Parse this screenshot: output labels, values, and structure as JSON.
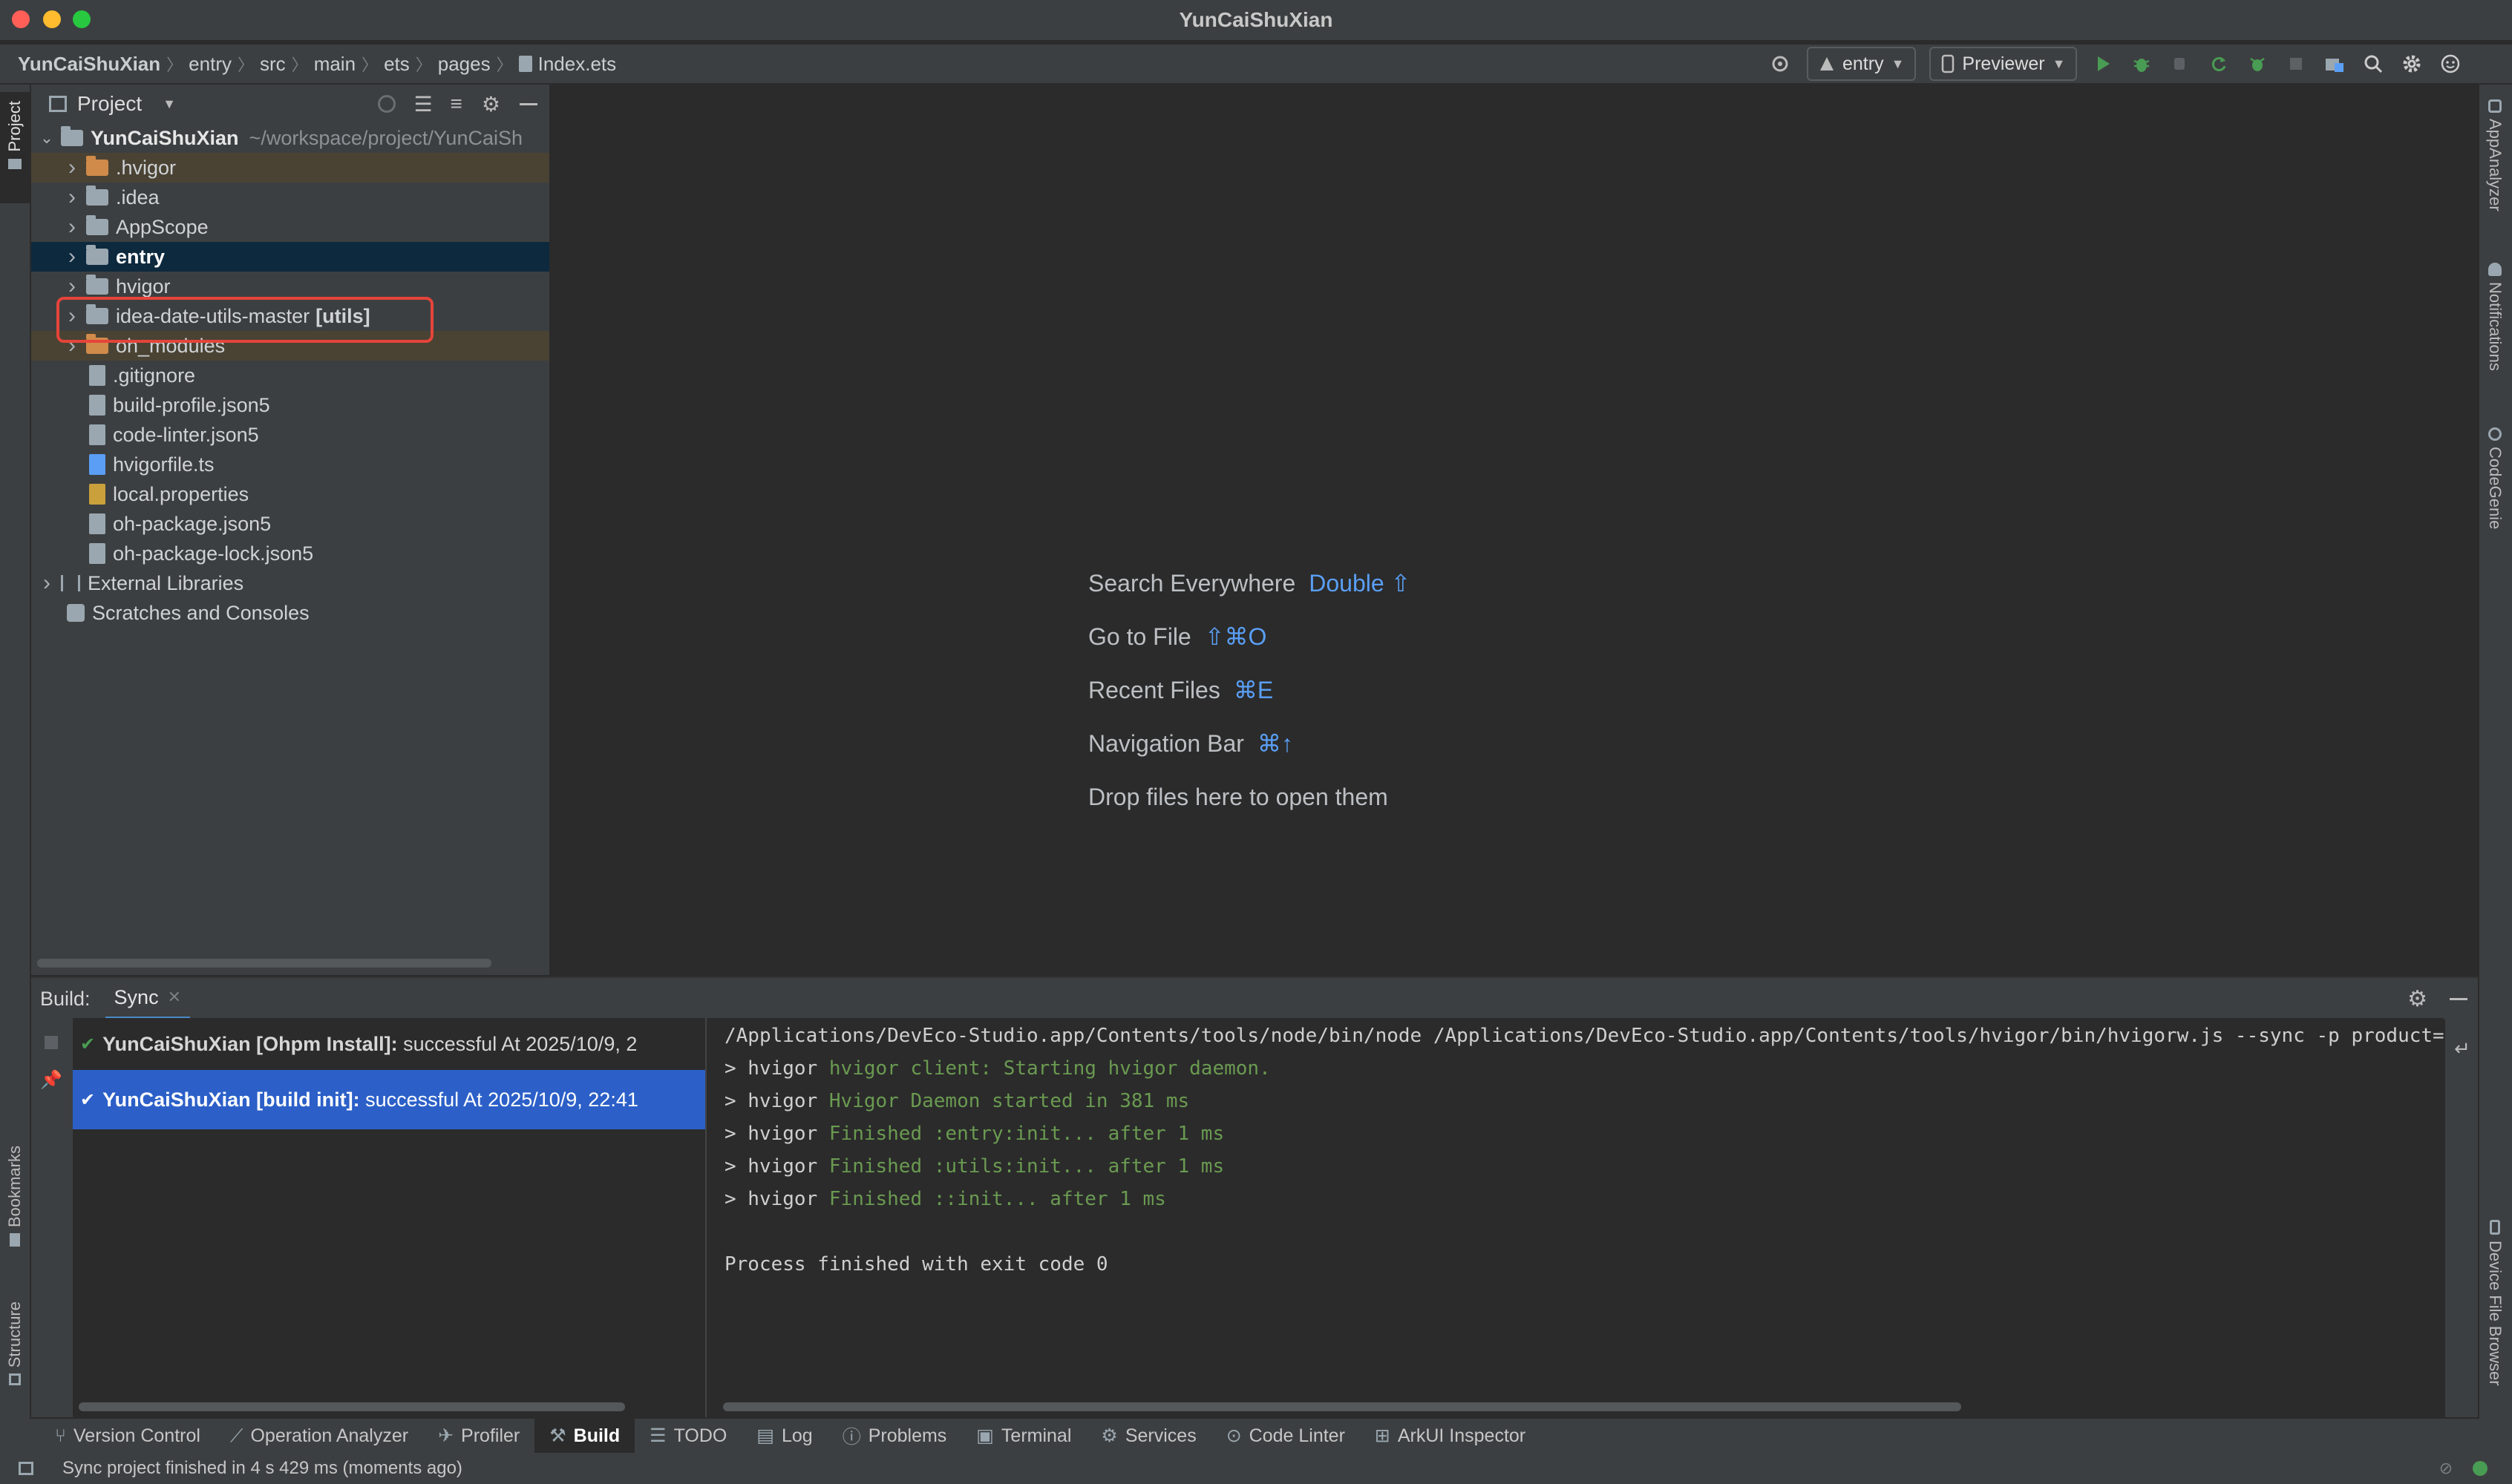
{
  "window": {
    "title": "YunCaiShuXian"
  },
  "breadcrumb": [
    "YunCaiShuXian",
    "entry",
    "src",
    "main",
    "ets",
    "pages",
    "Index.ets"
  ],
  "toolbar": {
    "module_selector": "entry",
    "device_selector": "Previewer"
  },
  "left_strip": {
    "project_label": "Project",
    "bookmarks_label": "Bookmarks",
    "structure_label": "Structure"
  },
  "right_strip": {
    "app_analyzer": "AppAnalyzer",
    "notifications": "Notifications",
    "code_genie": "CodeGenie",
    "device_file_browser": "Device File Browser"
  },
  "project_panel": {
    "title": "Project",
    "root": {
      "name": "YunCaiShuXian",
      "path": "~/workspace/project/YunCaiSh"
    },
    "items": [
      {
        "name": ".hvigor",
        "kind": "folder-excluded"
      },
      {
        "name": ".idea",
        "kind": "folder"
      },
      {
        "name": "AppScope",
        "kind": "folder"
      },
      {
        "name": "entry",
        "kind": "module"
      },
      {
        "name": "hvigor",
        "kind": "folder"
      },
      {
        "name": "idea-date-utils-master",
        "suffix": "[utils]",
        "kind": "module"
      },
      {
        "name": "oh_modules",
        "kind": "folder-excluded"
      },
      {
        "name": ".gitignore",
        "kind": "file"
      },
      {
        "name": "build-profile.json5",
        "kind": "file"
      },
      {
        "name": "code-linter.json5",
        "kind": "file"
      },
      {
        "name": "hvigorfile.ts",
        "kind": "ts-file"
      },
      {
        "name": "local.properties",
        "kind": "properties-file"
      },
      {
        "name": "oh-package.json5",
        "kind": "file"
      },
      {
        "name": "oh-package-lock.json5",
        "kind": "file"
      }
    ],
    "external_libraries": "External Libraries",
    "scratches": "Scratches and Consoles",
    "highlight_color": "#e5443a"
  },
  "editor_tips": [
    {
      "label": "Search Everywhere",
      "shortcut": "Double ⇧"
    },
    {
      "label": "Go to File",
      "shortcut": "⇧⌘O"
    },
    {
      "label": "Recent Files",
      "shortcut": "⌘E"
    },
    {
      "label": "Navigation Bar",
      "shortcut": "⌘↑"
    },
    {
      "label": "Drop files here to open them",
      "shortcut": ""
    }
  ],
  "build_panel": {
    "label": "Build:",
    "tab": "Sync",
    "items": [
      {
        "bold": "YunCaiShuXian [Ohpm Install]:",
        "text": " successful At 2025/10/9, 2"
      },
      {
        "bold": "YunCaiShuXian [build init]:",
        "text": " successful At 2025/10/9, 22:41"
      }
    ],
    "console": [
      {
        "prefix": "/Applications/DevEco-Studio.app/Contents/tools/node/bin/node /Applications/DevEco-Studio.app/Contents/tools/hvigor/bin/hvigorw.js --sync -p product=d",
        "msg": ""
      },
      {
        "prefix": "> hvigor ",
        "msg": "hvigor client: Starting hvigor daemon."
      },
      {
        "prefix": "> hvigor ",
        "msg": "Hvigor Daemon started in 381 ms"
      },
      {
        "prefix": "> hvigor ",
        "msg": "Finished :entry:init... after 1 ms"
      },
      {
        "prefix": "> hvigor ",
        "msg": "Finished :utils:init... after 1 ms"
      },
      {
        "prefix": "> hvigor ",
        "msg": "Finished ::init... after 1 ms"
      },
      {
        "prefix": "",
        "msg": ""
      },
      {
        "prefix": "Process finished with exit code 0",
        "msg": ""
      }
    ]
  },
  "tool_tabs": [
    "Version Control",
    "Operation Analyzer",
    "Profiler",
    "Build",
    "TODO",
    "Log",
    "Problems",
    "Terminal",
    "Services",
    "Code Linter",
    "ArkUI Inspector"
  ],
  "status": {
    "message": "Sync project finished in 4 s 429 ms (moments ago)"
  },
  "colors": {
    "accent": "#5a9ff5",
    "selection": "#2c60c8",
    "success": "#499c54",
    "console_green": "#6a9a51"
  }
}
